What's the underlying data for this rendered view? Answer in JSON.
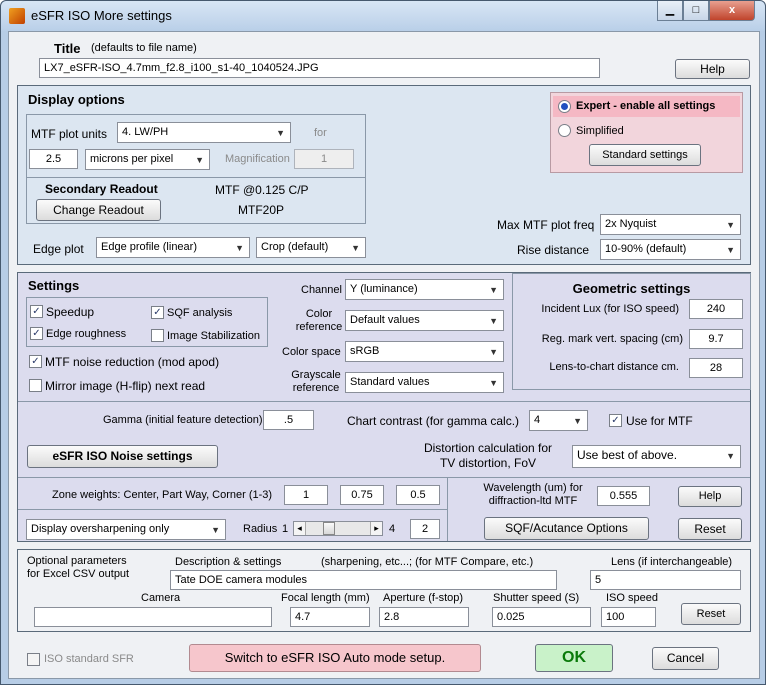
{
  "window": {
    "title": "eSFR ISO More settings",
    "controls": {
      "minimize": "▁",
      "maximize": "□",
      "close": "x"
    }
  },
  "header": {
    "title_label": "Title",
    "title_hint": "(defaults to file name)",
    "title_value": "LX7_eSFR-ISO_4.7mm_f2.8_i100_s1-40_1040524.JPG",
    "help": "Help"
  },
  "display": {
    "heading": "Display options",
    "mtf_units_label": "MTF plot units",
    "mtf_units_value": "4. LW/PH",
    "for_label": "for",
    "size_value": "2.5",
    "size_unit_value": "microns per pixel",
    "magnification_label": "Magnification",
    "magnification_value": "1",
    "secondary_readout": "Secondary Readout",
    "change_readout": "Change Readout",
    "readout_line1": "MTF @0.125 C/P",
    "readout_line2": "MTF20P",
    "edge_plot_label": "Edge plot",
    "edge_plot_value": "Edge profile (linear)",
    "crop_value": "Crop (default)",
    "expert": "Expert - enable all settings",
    "simplified": "Simplified",
    "standard_settings": "Standard settings",
    "max_freq_label": "Max MTF plot freq",
    "max_freq_value": "2x  Nyquist",
    "rise_label": "Rise distance",
    "rise_value": "10-90% (default)"
  },
  "settings": {
    "heading": "Settings",
    "speedup": "Speedup",
    "sqf": "SQF analysis",
    "edge_rough": "Edge roughness",
    "image_stab": "Image Stabilization",
    "noise_reduction": "MTF noise reduction (mod  apod)",
    "mirror": "Mirror image (H-flip) next read",
    "channel_label": "Channel",
    "channel_value": "Y (luminance)",
    "color_ref_label": "Color reference",
    "color_ref_line1": "Color",
    "color_ref_line2": "reference",
    "color_ref_value": "Default values",
    "color_space_label": "Color space",
    "color_space_value": "sRGB",
    "gray_ref_line1": "Grayscale",
    "gray_ref_line2": "reference",
    "gray_ref_value": "Standard values"
  },
  "geometric": {
    "heading": "Geometric settings",
    "lux_label": "Incident Lux (for ISO speed)",
    "lux_value": "240",
    "spacing_label": "Reg. mark vert. spacing (cm)",
    "spacing_value": "9.7",
    "distance_label": "Lens-to-chart distance cm.",
    "distance_value": "28"
  },
  "gamma": {
    "label": "Gamma (initial feature detection)",
    "value": ".5",
    "contrast_label": "Chart contrast (for gamma calc.)",
    "contrast_value": "4",
    "use_mtf": "Use for MTF",
    "noise_button": "eSFR ISO Noise settings",
    "distortion_line1": "Distortion calculation for",
    "distortion_line2": "TV distortion, FoV",
    "distortion_value": "Use best of above."
  },
  "zones": {
    "label": "Zone weights:  Center, Part Way, Corner (1-3)",
    "center": "1",
    "partway": "0.75",
    "corner": "0.5",
    "oversharp_value": "Display oversharpening only",
    "radius_label": "Radius",
    "radius_min": "1",
    "radius_max": "4",
    "radius_value": "2",
    "radius_fraction": 0.33,
    "wavelength_line1": "Wavelength (um) for",
    "wavelength_line2": "diffraction-ltd MTF",
    "wavelength_value": "0.555",
    "help": "Help",
    "sqf_button": "SQF/Acutance Options",
    "reset": "Reset"
  },
  "optional": {
    "heading_line1": "Optional parameters",
    "heading_line2": "for Excel CSV output",
    "desc_label": "Description & settings",
    "desc_hint": "(sharpening, etc...; (for MTF Compare, etc.)",
    "desc_value": "Tate DOE camera modules",
    "lens_label": "Lens (if interchangeable)",
    "lens_value": "5",
    "camera_label": "Camera",
    "camera_value": "",
    "focal_label": "Focal length (mm)",
    "focal_value": "4.7",
    "aperture_label": "Aperture (f-stop)",
    "aperture_value": "2.8",
    "shutter_label": "Shutter speed (S)",
    "shutter_value": "0.025",
    "iso_label": "ISO speed",
    "iso_value": "100",
    "reset": "Reset"
  },
  "footer": {
    "iso_sfr": "ISO standard SFR",
    "switch": "Switch to eSFR ISO Auto mode setup.",
    "ok": "OK",
    "cancel": "Cancel"
  },
  "checks": {
    "tick": "✓"
  },
  "icons": {
    "dropdown_arrow": "▼",
    "slider_left": "◂",
    "slider_right": "▸"
  }
}
